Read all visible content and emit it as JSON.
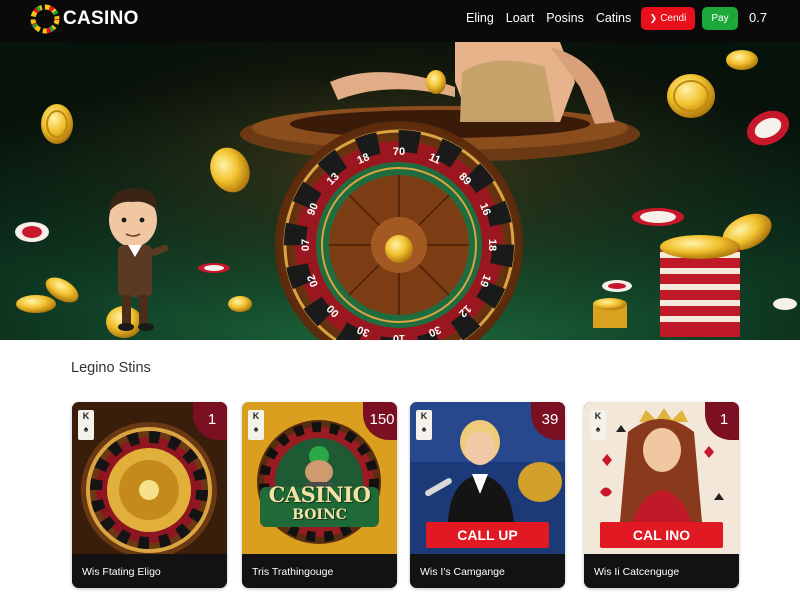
{
  "header": {
    "logo_text": "CASINO",
    "nav": [
      "Eling",
      "Loart",
      "Posins",
      "Catins"
    ],
    "button_red": "Cendi",
    "button_red_icon": "chevron-right-icon",
    "button_green": "Pay",
    "balance": "0.7"
  },
  "hero": {
    "wheel_numbers": [
      "70",
      "11",
      "89",
      "16",
      "18",
      "19",
      "12",
      "30",
      "10",
      "30",
      "00",
      "02",
      "07",
      "90",
      "13",
      "18"
    ]
  },
  "section": {
    "title": "Legino Stins"
  },
  "cards": [
    {
      "corner_rank": "K",
      "corner_suit": "♠",
      "badge": "1",
      "banner": "",
      "title_1": "",
      "title_2": "",
      "caption": "Wis Ftating Eligo"
    },
    {
      "corner_rank": "K",
      "corner_suit": "♠",
      "badge": "150",
      "banner": "",
      "title_1": "CASINIO",
      "title_2": "BOINC",
      "caption": "Tris Trathingouge"
    },
    {
      "corner_rank": "K",
      "corner_suit": "♠",
      "badge": "39",
      "banner": "CALL UP",
      "title_1": "",
      "title_2": "",
      "caption": "Wis I's Camgange"
    },
    {
      "corner_rank": "K",
      "corner_suit": "♠",
      "badge": "1",
      "banner": "CAL INO",
      "title_1": "",
      "title_2": "",
      "caption": "Wis Ii Catcenguge"
    }
  ],
  "colors": {
    "header_bg": "#0a0a0a",
    "accent_red": "#e8101a",
    "accent_green": "#1fa83a",
    "card_bg": "#121212"
  }
}
